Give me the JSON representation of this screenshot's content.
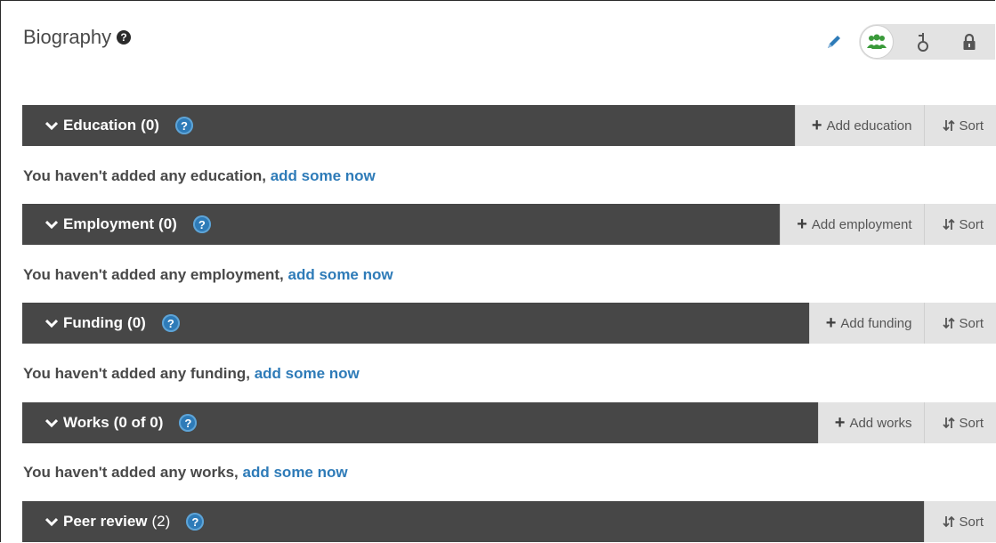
{
  "biography": {
    "title": "Biography",
    "help_icon": "question-circle-icon",
    "edit_icon": "pencil-icon",
    "visibility": [
      {
        "name": "everyone",
        "icon": "users-icon",
        "active": true,
        "color": "#3a9a3a"
      },
      {
        "name": "trusted",
        "icon": "key-icon",
        "active": false
      },
      {
        "name": "private",
        "icon": "lock-icon",
        "active": false
      }
    ]
  },
  "colors": {
    "bar": "#474747",
    "button_bg": "#e3e3e3",
    "link": "#2e7bb8"
  },
  "sections": {
    "education": {
      "title": "Education",
      "count": "(0)",
      "add_label": "Add education",
      "sort_label": "Sort",
      "empty_text": "You haven't added any education,",
      "empty_link": "add some now"
    },
    "employment": {
      "title": "Employment",
      "count": "(0)",
      "add_label": "Add employment",
      "sort_label": "Sort",
      "empty_text": "You haven't added any employment,",
      "empty_link": "add some now"
    },
    "funding": {
      "title": "Funding",
      "count": "(0)",
      "add_label": "Add funding",
      "sort_label": "Sort",
      "empty_text": "You haven't added any funding,",
      "empty_link": "add some now"
    },
    "works": {
      "title": "Works",
      "count": "(0 of 0)",
      "add_label": "Add works",
      "sort_label": "Sort",
      "empty_text": "You haven't added any works,",
      "empty_link": "add some now"
    },
    "peer_review": {
      "title": "Peer review",
      "count": "(2)",
      "sort_label": "Sort"
    }
  }
}
